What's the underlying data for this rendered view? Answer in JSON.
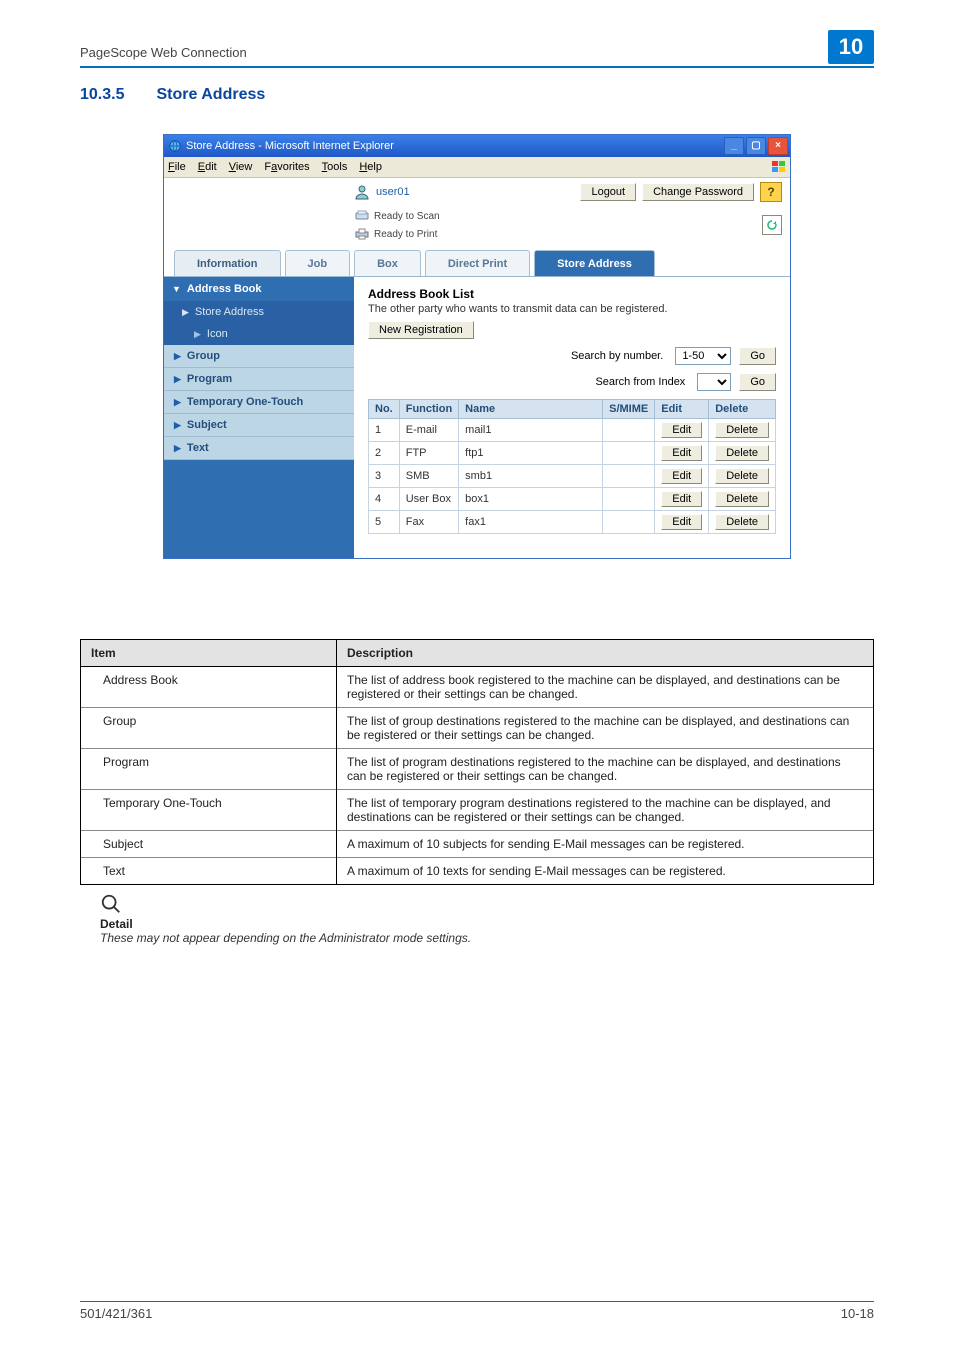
{
  "header": {
    "title": "PageScope Web Connection",
    "chapter": "10"
  },
  "section": {
    "number": "10.3.5",
    "title": "Store Address"
  },
  "ie_window": {
    "title": "Store Address - Microsoft Internet Explorer",
    "menus": [
      "File",
      "Edit",
      "View",
      "Favorites",
      "Tools",
      "Help"
    ],
    "user": "user01",
    "logout": "Logout",
    "change_password": "Change Password",
    "ready_scan": "Ready to Scan",
    "ready_print": "Ready to Print",
    "tabs": {
      "information": "Information",
      "job": "Job",
      "box": "Box",
      "direct_print": "Direct Print",
      "store_address": "Store Address"
    },
    "sidebar": {
      "address_book": "Address Book",
      "store_address": "Store Address",
      "icon": "Icon",
      "group": "Group",
      "program": "Program",
      "temporary": "Temporary One-Touch",
      "subject": "Subject",
      "text": "Text"
    },
    "content": {
      "heading": "Address Book List",
      "note": "The other party who wants to transmit data can be registered.",
      "new_reg": "New Registration",
      "search_by_number": "Search by number.",
      "search_from_index": "Search from Index",
      "range": "1-50",
      "go": "Go",
      "columns": {
        "no": "No.",
        "function": "Function",
        "name": "Name",
        "smime": "S/MIME",
        "edit": "Edit",
        "delete": "Delete"
      },
      "rows": [
        {
          "no": "1",
          "function": "E-mail",
          "name": "mail1"
        },
        {
          "no": "2",
          "function": "FTP",
          "name": "ftp1"
        },
        {
          "no": "3",
          "function": "SMB",
          "name": "smb1"
        },
        {
          "no": "4",
          "function": "User Box",
          "name": "box1"
        },
        {
          "no": "5",
          "function": "Fax",
          "name": "fax1"
        }
      ],
      "edit": "Edit",
      "delete": "Delete"
    }
  },
  "descriptions": {
    "item": "Item",
    "description": "Description",
    "rows": [
      {
        "item": "Address Book",
        "desc": "The list of address book registered to the machine can be displayed, and destinations can be registered or their settings can be changed."
      },
      {
        "item": "Group",
        "desc": "The list of group destinations registered to the machine can be displayed, and destinations can be registered or their settings can be changed."
      },
      {
        "item": "Program",
        "desc": "The list of program destinations registered to the machine can be displayed, and destinations can be registered or their settings can be changed."
      },
      {
        "item": "Temporary One-Touch",
        "desc": "The list of temporary program destinations registered to the machine can be displayed, and destinations can be registered or their settings can be changed."
      },
      {
        "item": "Subject",
        "desc": "A maximum of 10 subjects for sending E-Mail messages can be registered."
      },
      {
        "item": "Text",
        "desc": "A maximum of 10 texts for sending E-Mail messages can be registered."
      }
    ]
  },
  "detail": {
    "heading": "Detail",
    "text": "These may not appear depending on the Administrator mode settings."
  },
  "footer": {
    "left": "501/421/361",
    "right": "10-18"
  }
}
